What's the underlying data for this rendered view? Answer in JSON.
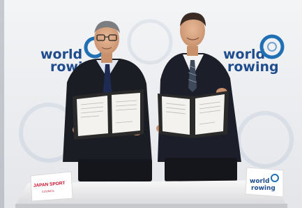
{
  "backdrop": {
    "brand_text_line1": "world",
    "brand_text_line2": "rowing",
    "brand_color": "#1e4c8c",
    "ring_color": "#1f6fb4"
  },
  "signatories": {
    "left_folder_color": "#2a2a2a",
    "right_folder_color": "#2a2a2a"
  },
  "table": {
    "left_card": {
      "line1": "JAPAN SPORT",
      "line2": "COUNCIL",
      "accent_color": "#c8102e"
    },
    "right_card": {
      "line1": "world",
      "line2": "rowing"
    }
  }
}
